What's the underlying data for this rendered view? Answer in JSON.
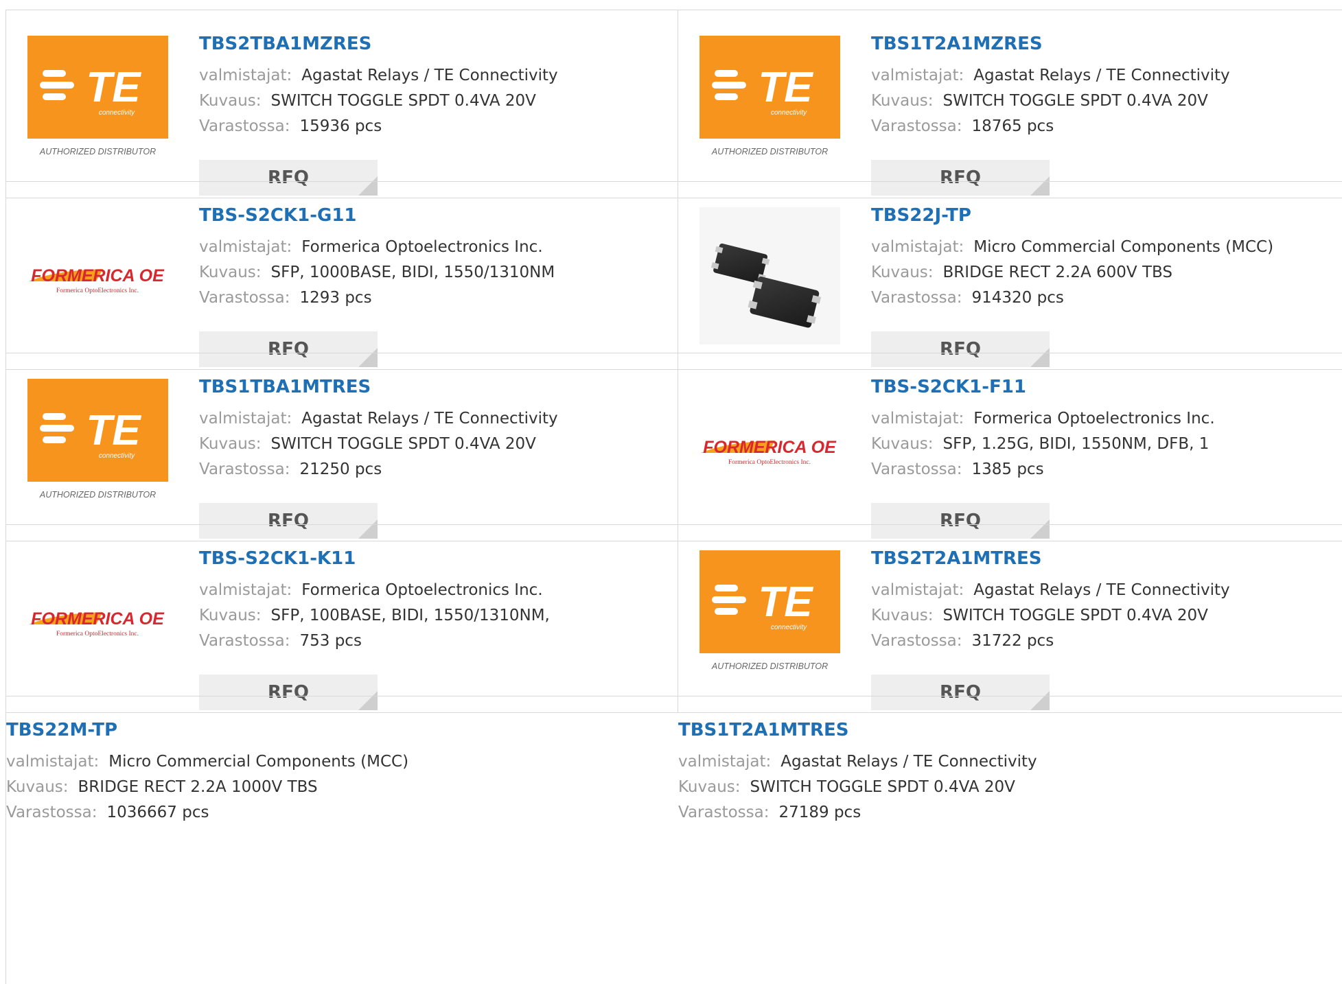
{
  "labels": {
    "manufacturer": "valmistajat:",
    "description": "Kuvaus:",
    "stock": "Varastossa:",
    "rfq": "RFQ"
  },
  "logos": {
    "te": {
      "brand_text": "TE",
      "sub_text": "connectivity",
      "caption": "AUTHORIZED DISTRIBUTOR",
      "bg_color": "#f7941d"
    },
    "formerica": {
      "brand_text": "FORMERICA OE",
      "sub_text": "Formerica OptoElectronics Inc.",
      "color_red": "#d7282f",
      "color_orange": "#f7a11a"
    },
    "mcc_chip": {
      "icon": "smd-chip-image"
    }
  },
  "products": [
    {
      "part": "TBS2TBA1MZRES",
      "manufacturer": "Agastat Relays / TE Connectivity",
      "description": "SWITCH TOGGLE SPDT 0.4VA 20V",
      "stock": "15936 pcs",
      "logo": "te"
    },
    {
      "part": "TBS1T2A1MZRES",
      "manufacturer": "Agastat Relays / TE Connectivity",
      "description": "SWITCH TOGGLE SPDT 0.4VA 20V",
      "stock": "18765 pcs",
      "logo": "te"
    },
    {
      "part": "TBS-S2CK1-G11",
      "manufacturer": "Formerica Optoelectronics Inc.",
      "description": "SFP, 1000BASE, BIDI, 1550/1310NM",
      "stock": "1293 pcs",
      "logo": "formerica"
    },
    {
      "part": "TBS22J-TP",
      "manufacturer": "Micro Commercial Components (MCC)",
      "description": "BRIDGE RECT 2.2A 600V TBS",
      "stock": "914320 pcs",
      "logo": "mcc_chip"
    },
    {
      "part": "TBS1TBA1MTRES",
      "manufacturer": "Agastat Relays / TE Connectivity",
      "description": "SWITCH TOGGLE SPDT 0.4VA 20V",
      "stock": "21250 pcs",
      "logo": "te"
    },
    {
      "part": "TBS-S2CK1-F11",
      "manufacturer": "Formerica Optoelectronics Inc.",
      "description": "SFP, 1.25G, BIDI, 1550NM, DFB, 1",
      "stock": "1385 pcs",
      "logo": "formerica"
    },
    {
      "part": "TBS-S2CK1-K11",
      "manufacturer": "Formerica Optoelectronics Inc.",
      "description": "SFP, 100BASE, BIDI, 1550/1310NM,",
      "stock": "753 pcs",
      "logo": "formerica"
    },
    {
      "part": "TBS2T2A1MTRES",
      "manufacturer": "Agastat Relays / TE Connectivity",
      "description": "SWITCH TOGGLE SPDT 0.4VA 20V",
      "stock": "31722 pcs",
      "logo": "te"
    },
    {
      "part": "TBS22M-TP",
      "manufacturer": "Micro Commercial Components (MCC)",
      "description": "BRIDGE RECT 2.2A 1000V TBS",
      "stock": "1036667 pcs",
      "logo": ""
    },
    {
      "part": "TBS1T2A1MTRES",
      "manufacturer": "Agastat Relays / TE Connectivity",
      "description": "SWITCH TOGGLE SPDT 0.4VA 20V",
      "stock": "27189 pcs",
      "logo": ""
    }
  ]
}
